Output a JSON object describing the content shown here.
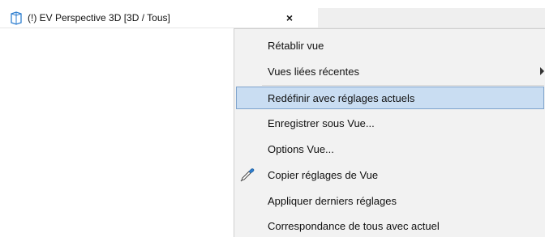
{
  "tab": {
    "label": "(!) EV Perspective 3D [3D / Tous]",
    "close_glyph": "×",
    "icon": "cube-view-icon"
  },
  "menu": {
    "items": [
      {
        "label": "Rétablir vue"
      },
      {
        "label": "Vues liées récentes",
        "has_submenu": true
      },
      {
        "label": "Redéfinir avec réglages actuels",
        "highlighted": true
      },
      {
        "label": "Enregistrer sous Vue..."
      },
      {
        "label": "Options Vue..."
      },
      {
        "label": "Copier réglages de Vue",
        "icon": "eyedropper-icon"
      },
      {
        "label": "Appliquer derniers réglages"
      },
      {
        "label": "Correspondance de tous avec actuel"
      }
    ]
  },
  "colors": {
    "highlight_bg": "#c9ddf2",
    "highlight_border": "#7ea3cc",
    "menu_bg": "#f2f2f2",
    "icon_blue": "#2f7fd0"
  }
}
